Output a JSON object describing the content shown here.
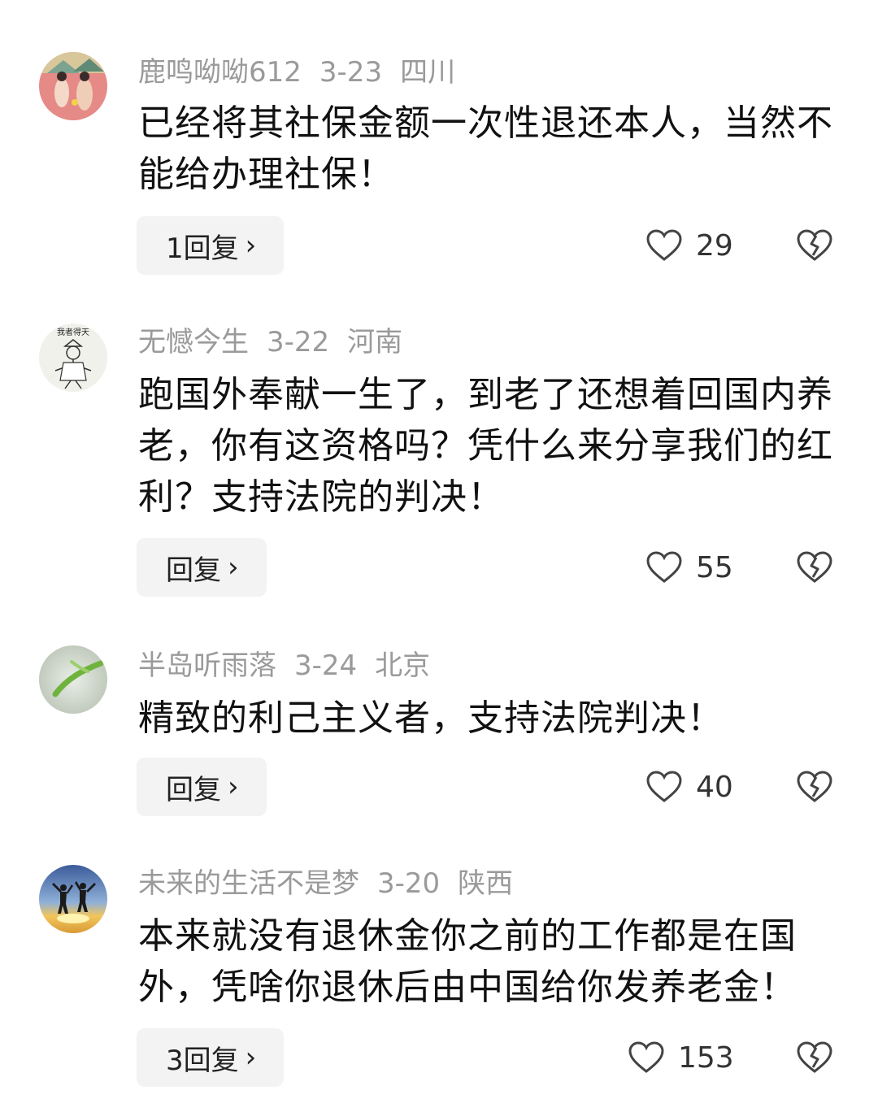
{
  "comments": [
    {
      "username": "鹿鸣呦呦612",
      "date": "3-23",
      "location": "四川",
      "text": "已经将其社保金额一次性退还本人，当然不能给办理社保！",
      "reply_label": "1回复",
      "likes": "29",
      "avatar_icon": "illustrated-figures-avatar"
    },
    {
      "username": "无憾今生",
      "date": "3-22",
      "location": "河南",
      "text": "跑国外奉献一生了，到老了还想着回国内养老，你有这资格吗？凭什么来分享我们的红利？支持法院的判决！",
      "reply_label": "回复",
      "likes": "55",
      "avatar_icon": "sketch-figure-avatar",
      "avatar_text": "我者得天"
    },
    {
      "username": "半岛听雨落",
      "date": "3-24",
      "location": "北京",
      "text": "精致的利己主义者，支持法院判决！",
      "reply_label": "回复",
      "likes": "40",
      "avatar_icon": "green-leaf-avatar"
    },
    {
      "username": "未来的生活不是梦",
      "date": "3-20",
      "location": "陕西",
      "text": "本来就没有退休金你之前的工作都是在国外，凭啥你退休后由中国给你发养老金！",
      "reply_label": "3回复",
      "likes": "153",
      "avatar_icon": "jumping-people-sunset-avatar"
    }
  ],
  "icons": {
    "like": "heart-outline-icon",
    "dislike": "broken-heart-icon",
    "reply_arrow": "chevron-right-icon"
  },
  "colors": {
    "meta_text": "#9a9a9a",
    "reply_bg": "#f3f3f3"
  }
}
